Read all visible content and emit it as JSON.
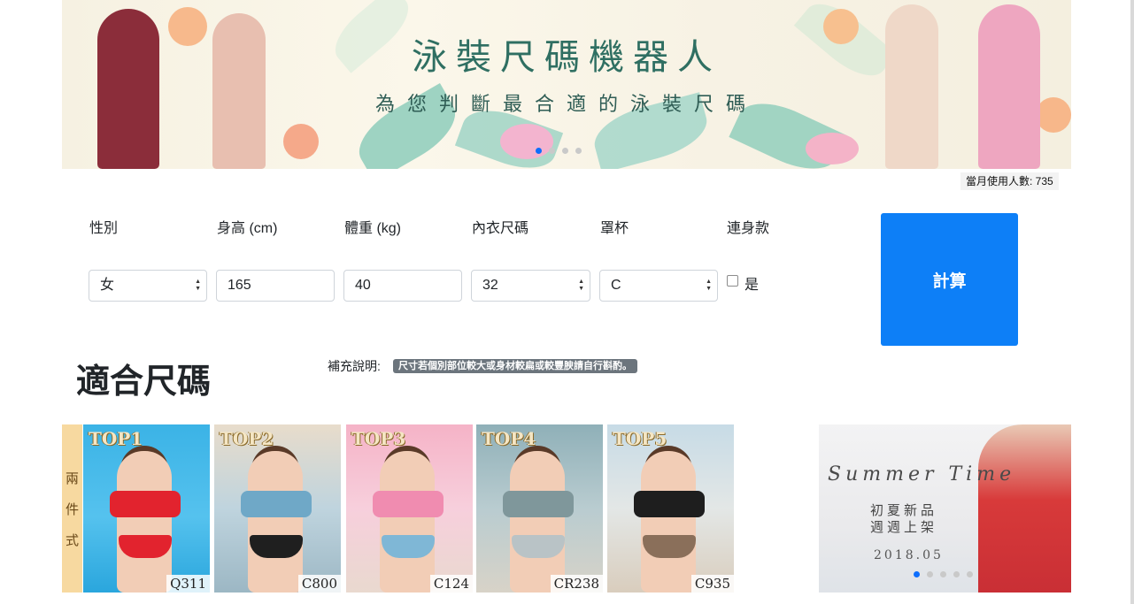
{
  "banner": {
    "title": "泳裝尺碼機器人",
    "subtitle": "為您判斷最合適的泳裝尺碼",
    "slide_count": 4,
    "active_slide": 1
  },
  "usage_text": "當月使用人數: 735",
  "form": {
    "labels": {
      "gender": "性別",
      "height": "身高 (cm)",
      "weight": "體重 (kg)",
      "bra_size": "內衣尺碼",
      "cup": "罩杯",
      "one_piece": "連身款"
    },
    "values": {
      "gender": "女",
      "height": "165",
      "weight": "40",
      "bra_size": "32",
      "cup": "C"
    },
    "one_piece_option": "是",
    "one_piece_checked": false,
    "submit_label": "計算"
  },
  "results": {
    "title": "適合尺碼",
    "note_label": "補充說明:",
    "note_badge": "尺寸若個別部位較大或身材較扁或較豐腴請自行斟酌。"
  },
  "top_products": {
    "category": [
      "兩",
      "件",
      "式"
    ],
    "items": [
      {
        "rank": "TOP1",
        "code": "Q311"
      },
      {
        "rank": "TOP2",
        "code": "C800"
      },
      {
        "rank": "TOP3",
        "code": "C124"
      },
      {
        "rank": "TOP4",
        "code": "CR238"
      },
      {
        "rank": "TOP5",
        "code": "C935"
      }
    ]
  },
  "promo": {
    "script": "Summer Time",
    "line1": "初夏新品",
    "line2": "週週上架",
    "date": "2018.05",
    "slide_count": 5,
    "active_slide": 1
  },
  "colors": {
    "primary": "#0d7ff7",
    "badge": "#6c757d",
    "title_green": "#2f6f62"
  }
}
